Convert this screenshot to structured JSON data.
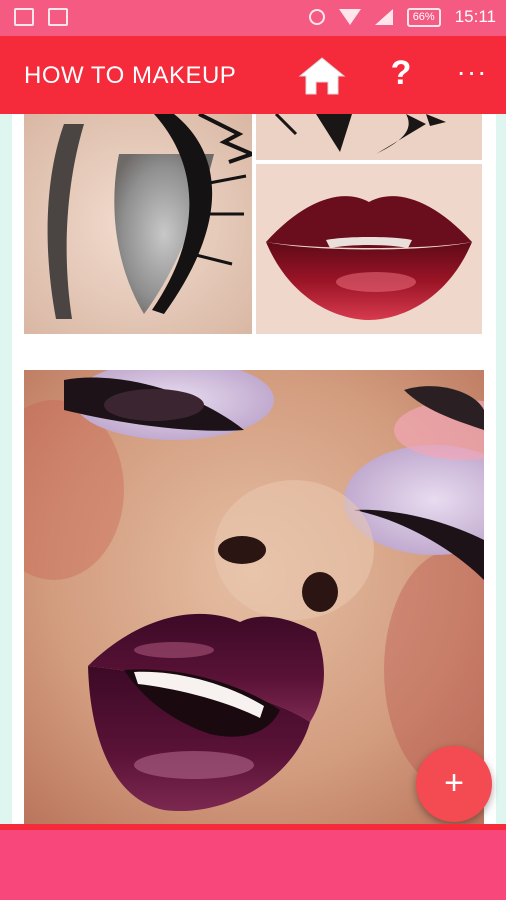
{
  "status_bar": {
    "time": "15:11",
    "battery": "66%",
    "icons": [
      "chat-icon",
      "image-icon",
      "alarm-icon",
      "wifi-icon",
      "signal-icon",
      "battery-icon"
    ]
  },
  "app_bar": {
    "title": "HOW TO MAKEUP",
    "help_label": "?",
    "more_label": "···",
    "color": "#f52a3b"
  },
  "fab": {
    "label": "+",
    "color": "#f44a52"
  },
  "colors": {
    "status_bar": "#f55a83",
    "background": "#dff5f0",
    "bottom_bar": "#f8477a"
  },
  "images": [
    {
      "subject": "eye-makeup-grey-shadow"
    },
    {
      "subject": "eyelashes-closeup"
    },
    {
      "subject": "red-lips-glitter"
    },
    {
      "subject": "face-purple-lips-lilac-eyeshadow"
    }
  ]
}
